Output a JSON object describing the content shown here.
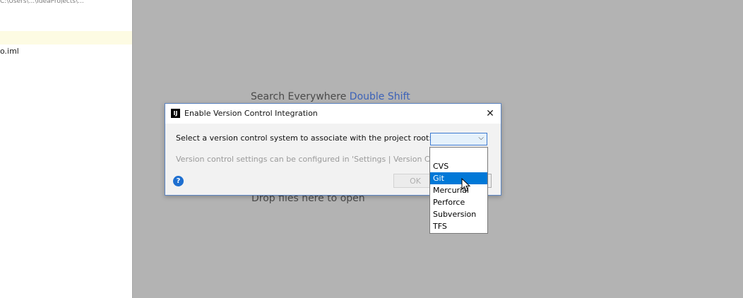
{
  "sidebar": {
    "top_path": "C:\\Users\\...\\IdeaProjects\\...",
    "file_label": "o.iml"
  },
  "editor": {
    "search_hint": "Search Everywhere",
    "search_shortcut": "Double Shift",
    "drop_hint": "Drop files here to open"
  },
  "dialog": {
    "title": "Enable Version Control Integration",
    "close_glyph": "✕",
    "vcs_label": "Select a version control system to associate with the project root:",
    "vcs_selected": "",
    "settings_note": "Version control settings can be configured in 'Settings | Version Control'",
    "help_glyph": "?",
    "ok_label": "OK",
    "options": [
      "",
      "CVS",
      "Git",
      "Mercurial",
      "Perforce",
      "Subversion",
      "TFS"
    ],
    "highlighted_option": "Git"
  },
  "colors": {
    "accent": "#0078d7",
    "shortcut": "#3c62b8",
    "help": "#1e6fd0"
  }
}
